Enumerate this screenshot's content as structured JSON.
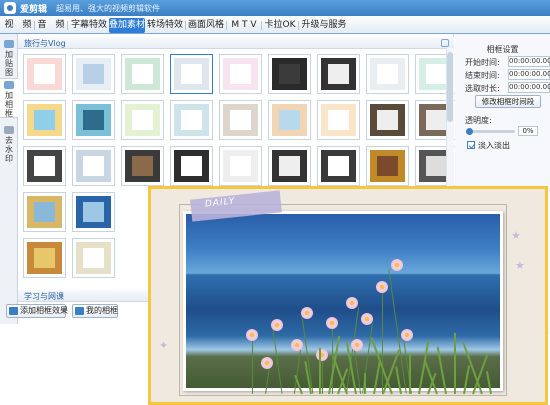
{
  "app": {
    "name": "爱剪辑",
    "slogan": "超易用、强大的视频剪辑软件"
  },
  "menu": {
    "tabs": [
      {
        "label": "视　频",
        "active": false
      },
      {
        "label": "音　频",
        "active": false
      },
      {
        "label": "字幕特效",
        "active": false
      },
      {
        "label": "叠加素材",
        "active": true
      },
      {
        "label": "转场特效",
        "active": false
      },
      {
        "label": "画面风格",
        "active": false
      },
      {
        "label": "M T V",
        "active": false
      },
      {
        "label": "卡拉OK",
        "active": false
      },
      {
        "label": "升级与服务",
        "active": false
      }
    ]
  },
  "leftnav": {
    "items": [
      {
        "label": "加贴图",
        "active": false
      },
      {
        "label": "加相框",
        "active": true
      },
      {
        "label": "去水印",
        "active": false
      }
    ]
  },
  "gallery": {
    "categories": [
      {
        "label": "旅行与Vlog"
      },
      {
        "label": "学习与网课"
      }
    ],
    "thumb_count": 31
  },
  "bottom": {
    "add_label": "添加相框效果",
    "mine_label": "我的相框"
  },
  "settings": {
    "title": "相框设置",
    "start_label": "开始时间:",
    "start_value": "00:00:00.000",
    "end_label": "结束时间:",
    "end_value": "00:00:00.000",
    "duration_label": "选取时长:",
    "duration_value": "00:00:00.000",
    "modify_label": "修改相框时间段",
    "opacity_label": "透明度:",
    "opacity_value": "0%",
    "opacity_level": 0,
    "fade_label": "淡入淡出",
    "fade_checked": true
  },
  "preview": {
    "tag_text": "DAILY"
  }
}
